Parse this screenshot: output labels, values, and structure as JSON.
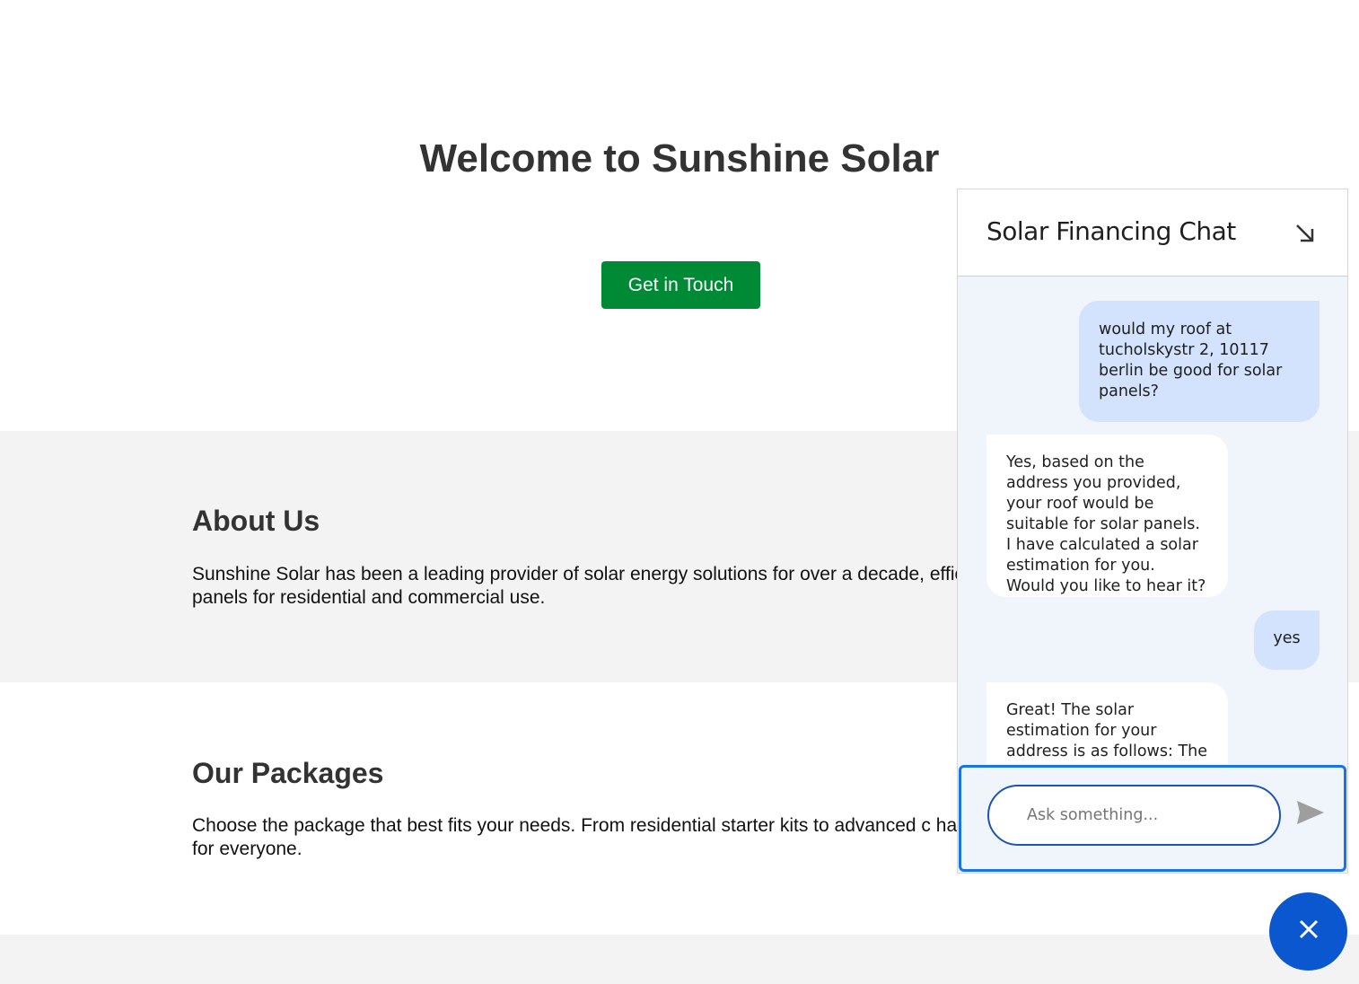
{
  "hero": {
    "title": "Welcome to Sunshine Solar",
    "cta_label": "Get in Touch"
  },
  "about": {
    "heading": "About Us",
    "text": "Sunshine Solar has been a leading provider of solar energy solutions for over a decade, efficient solar panels for residential and commercial use."
  },
  "packages": {
    "heading": "Our Packages",
    "text": "Choose the package that best fits your needs. From residential starter kits to advanced c have something for everyone."
  },
  "chat": {
    "title": "Solar Financing Chat",
    "minimize_icon": "arrow-down-right-icon",
    "messages": [
      {
        "role": "user",
        "text": "would my roof at tucholskystr 2, 10117 berlin be good for solar panels?"
      },
      {
        "role": "bot",
        "text": "Yes, based on the address you provided, your roof would be suitable for solar panels. I have calculated a solar estimation for you. Would you like to hear it?"
      },
      {
        "role": "user",
        "text": "yes"
      },
      {
        "role": "bot",
        "text": "Great! The solar estimation for your address is as follows: The"
      }
    ],
    "input_placeholder": "Ask something...",
    "send_icon": "send-icon",
    "scroll_icon": "arrow-down-icon"
  },
  "fab": {
    "icon": "close-icon"
  },
  "colors": {
    "cta": "#008a35",
    "user_bubble": "#d3e3fd",
    "chat_bg": "#f0f4fb",
    "focus_border": "#1a73e8",
    "fab": "#0b57d0"
  }
}
